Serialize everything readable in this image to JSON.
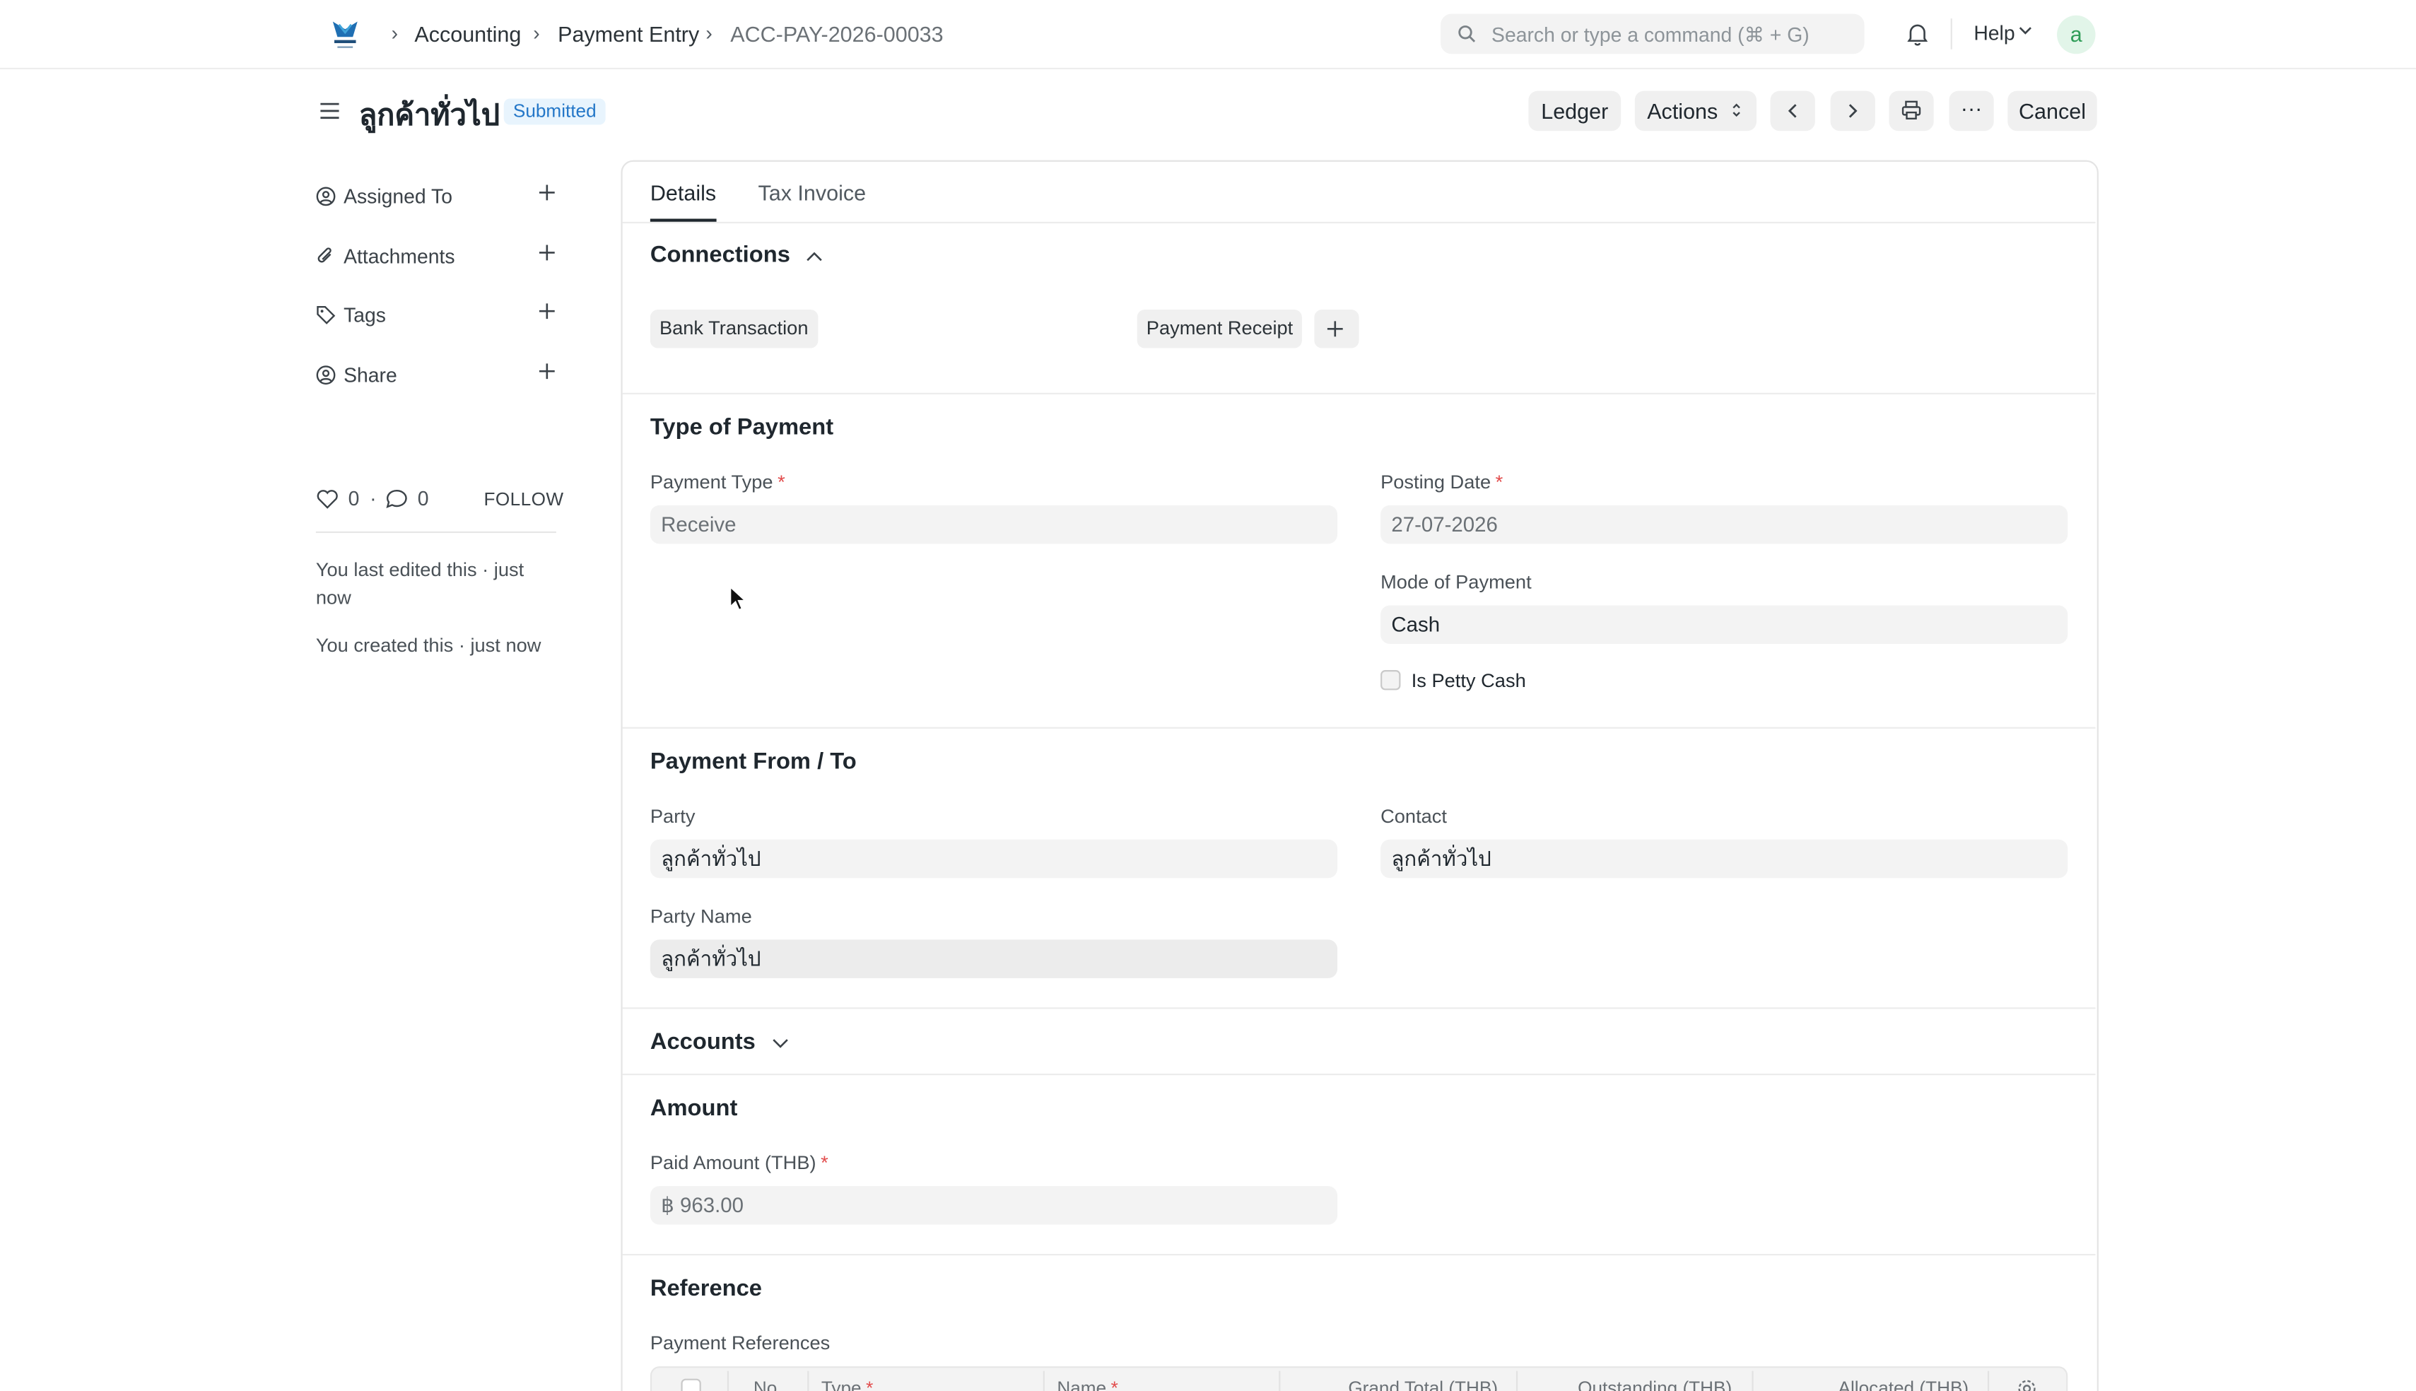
{
  "navbar": {
    "breadcrumbs": [
      "Accounting",
      "Payment Entry",
      "ACC-PAY-2026-00033"
    ],
    "search_placeholder": "Search or type a command (⌘ + G)",
    "help_label": "Help",
    "avatar_initial": "a"
  },
  "page": {
    "title": "ลูกค้าทั่วไป",
    "status": "Submitted",
    "status_color": "#2477c8",
    "buttons": {
      "ledger": "Ledger",
      "actions": "Actions",
      "more": "···",
      "cancel": "Cancel"
    }
  },
  "sidebar": {
    "items": [
      {
        "label": "Assigned To",
        "icon": "add-user-icon"
      },
      {
        "label": "Attachments",
        "icon": "paperclip-icon"
      },
      {
        "label": "Tags",
        "icon": "tag-icon"
      },
      {
        "label": "Share",
        "icon": "share-user-icon"
      }
    ],
    "likes": "0",
    "comments": "0",
    "follow_label": "FOLLOW",
    "last_edited": "You last edited this · just now",
    "created": "You created this · just now"
  },
  "tabs": [
    "Details",
    "Tax Invoice"
  ],
  "connections": {
    "title": "Connections",
    "items": [
      "Bank Transaction",
      "Payment Receipt"
    ]
  },
  "type_of_payment": {
    "title": "Type of Payment",
    "payment_type_label": "Payment Type",
    "payment_type_value": "Receive",
    "posting_date_label": "Posting Date",
    "posting_date_value": "27-07-2026",
    "mode_of_payment_label": "Mode of Payment",
    "mode_of_payment_value": "Cash",
    "is_petty_cash_label": "Is Petty Cash"
  },
  "payment_from_to": {
    "title": "Payment From / To",
    "party_label": "Party",
    "party_value": "ลูกค้าทั่วไป",
    "contact_label": "Contact",
    "contact_value": "ลูกค้าทั่วไป",
    "party_name_label": "Party Name",
    "party_name_value": "ลูกค้าทั่วไป"
  },
  "accounts": {
    "title": "Accounts"
  },
  "amount": {
    "title": "Amount",
    "paid_amount_label": "Paid Amount (THB)",
    "paid_amount_value": "฿ 963.00"
  },
  "reference": {
    "title": "Reference",
    "table_label": "Payment References",
    "columns": [
      "No.",
      "Type",
      "Name",
      "Grand Total (THB)",
      "Outstanding (THB)",
      "Allocated (THB)"
    ]
  }
}
